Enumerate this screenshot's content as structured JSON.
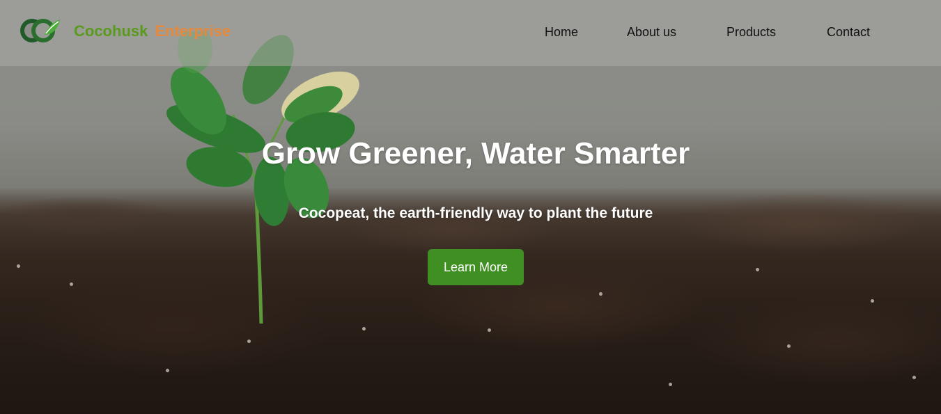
{
  "brand": {
    "name_primary": "Cocohusk",
    "name_secondary": "Enterprise",
    "logo_icon": "coconut-leaf-logo-icon",
    "primary_color": "#5a9a1f",
    "secondary_color": "#e38a3e"
  },
  "nav": {
    "items": [
      {
        "label": "Home"
      },
      {
        "label": "About us"
      },
      {
        "label": "Products"
      },
      {
        "label": "Contact"
      }
    ]
  },
  "hero": {
    "headline": "Grow Greener, Water Smarter",
    "subheadline": "Cocopeat, the earth-friendly way to plant the future",
    "cta_label": "Learn More",
    "cta_color": "#3f8f23",
    "background_image": "seedling-in-soil"
  }
}
